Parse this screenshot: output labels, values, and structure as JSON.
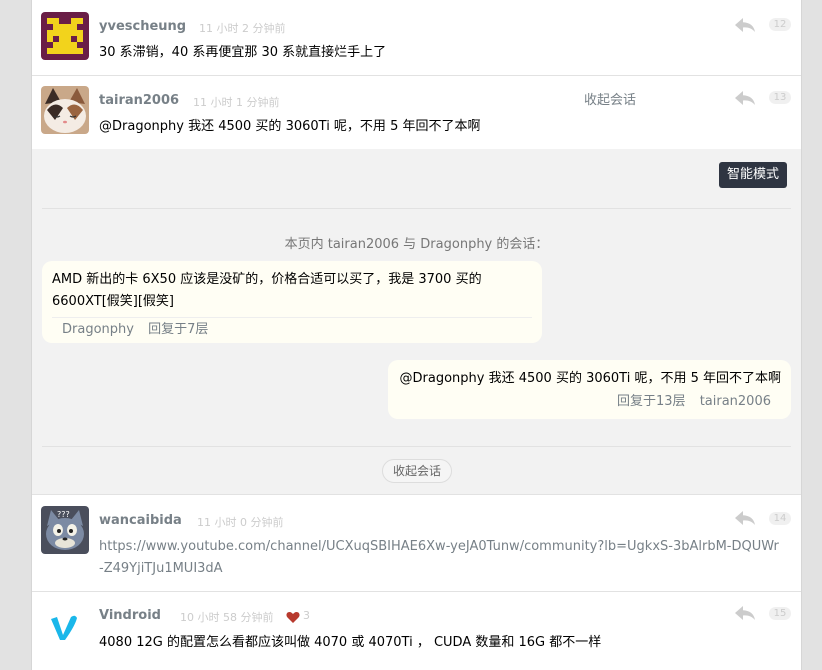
{
  "replies": [
    {
      "username": "yvescheung",
      "time": "11 小时 2 分钟前",
      "content": "30 系滞销，40 系再便宜那 30 系就直接烂手上了",
      "floor": "12"
    },
    {
      "username": "tairan2006",
      "time": "11 小时 1 分钟前",
      "content": "@Dragonphy 我还 4500 买的 3060Ti 呢，不用 5 年回不了本啊",
      "floor": "13",
      "collapse_label": "收起会话"
    },
    {
      "username": "wancaibida",
      "time": "11 小时 0 分钟前",
      "content": "https://www.youtube.com/channel/UCXuqSBIHAE6Xw-yeJA0Tunw/community?lb=UgkxS-3bAlrbM-DQUWr-Z49YjiTJu1MUI3dA",
      "floor": "14"
    },
    {
      "username": "Vindroid",
      "time": "10 小时 58 分钟前",
      "likes": "3",
      "content": "4080 12G 的配置怎么看都应该叫做 4070 或 4070Ti ， CUDA 数量和 16G 都不一样",
      "floor": "15"
    }
  ],
  "conversation": {
    "smart_mode_label": "智能模式",
    "title": "本页内 tairan2006 与 Dragonphy 的会话：",
    "left_bubble": {
      "text": "AMD 新出的卡 6X50 应该是没矿的，价格合适可以买了，我是 3700 买的 6600XT[假笑][假笑]",
      "author": "Dragonphy",
      "reply_to": "回复于7层"
    },
    "right_bubble": {
      "text": "@Dragonphy 我还 4500 买的 3060Ti 呢，不用 5 年回不了本啊",
      "reply_to": "回复于13层",
      "author": "tairan2006"
    },
    "collapse_label": "收起会话"
  },
  "colors": {
    "username": "#778087",
    "muted": "#cccccc",
    "bubble_bg": "#fffef4",
    "smart_button_bg": "#2f3542",
    "heart": "#b83a2e"
  },
  "icons": [
    "reply-arrow-icon",
    "heart-icon"
  ]
}
